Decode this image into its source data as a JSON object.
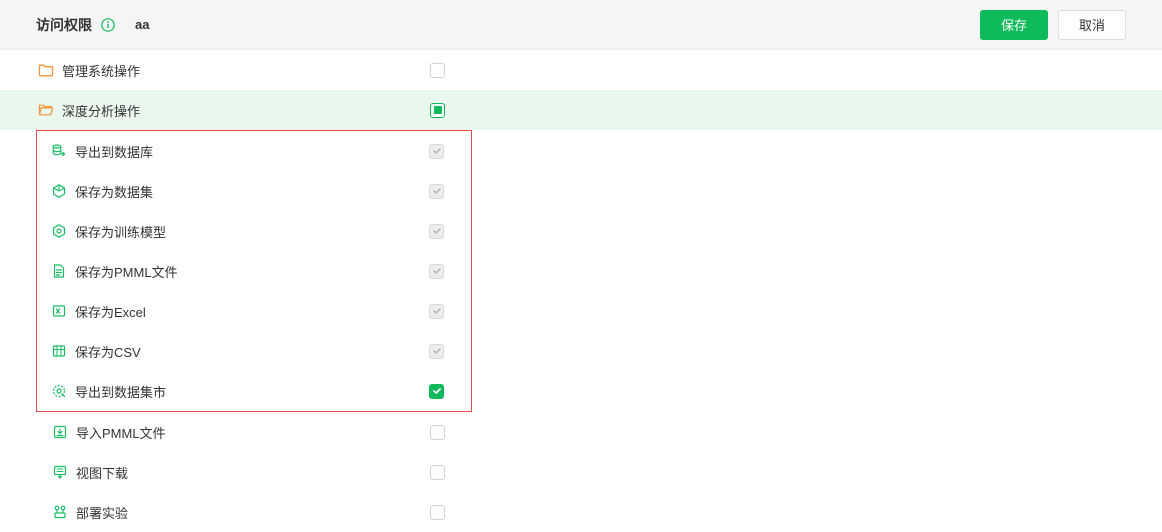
{
  "header": {
    "title": "访问权限",
    "subtitle": "aa",
    "save_label": "保存",
    "cancel_label": "取消"
  },
  "rows": {
    "folder1": "管理系统操作",
    "folder2": "深度分析操作",
    "child1": "导出到数据库",
    "child2": "保存为数据集",
    "child3": "保存为训练模型",
    "child4": "保存为PMML文件",
    "child5": "保存为Excel",
    "child6": "保存为CSV",
    "child7": "导出到数据集市",
    "item8": "导入PMML文件",
    "item9": "视图下载",
    "item10": "部署实验"
  }
}
